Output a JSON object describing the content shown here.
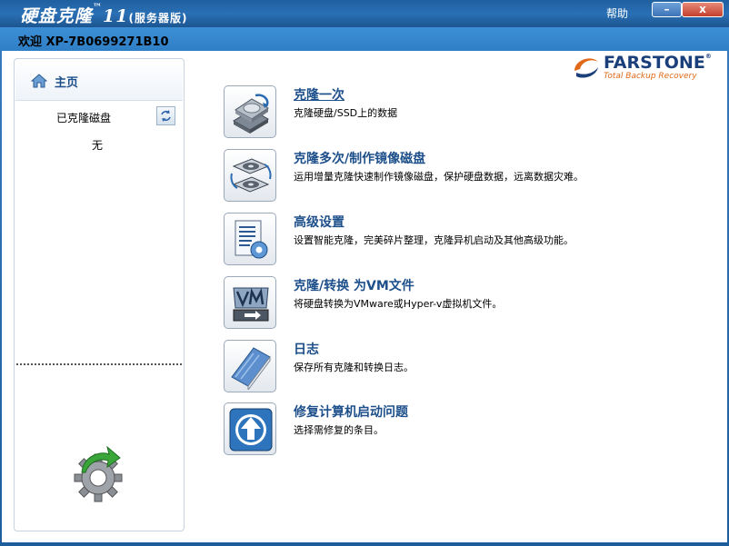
{
  "titlebar": {
    "app_name": "硬盘克隆",
    "tm": "™",
    "version": "11",
    "edition": "(服务器版)",
    "help": "帮助",
    "minimize": "–",
    "close": "x"
  },
  "welcome": "欢迎 XP-7B0699271B10",
  "logo": {
    "name": "FARSTONE",
    "tagline": "Total Backup Recovery",
    "reg": "®"
  },
  "sidebar": {
    "home_label": "主页",
    "cloned_disks_label": "已克隆磁盘",
    "none_label": "无"
  },
  "menu": [
    {
      "title": "克隆一次",
      "desc": "克隆硬盘/SSD上的数据",
      "icon": "hard-disk-clone-icon"
    },
    {
      "title": "克隆多次/制作镜像磁盘",
      "desc": "运用增量克隆快速制作镜像磁盘，保护硬盘数据，远离数据灾难。",
      "icon": "mirror-disk-icon"
    },
    {
      "title": "高级设置",
      "desc": "设置智能克隆，完美碎片整理，克隆异机启动及其他高级功能。",
      "icon": "settings-document-icon"
    },
    {
      "title": "克隆/转换 为VM文件",
      "desc": "将硬盘转换为VMware或Hyper-v虚拟机文件。",
      "icon": "vm-convert-icon"
    },
    {
      "title": "日志",
      "desc": "保存所有克隆和转换日志。",
      "icon": "log-book-icon"
    },
    {
      "title": "修复计算机启动问题",
      "desc": "选择需修复的条目。",
      "icon": "boot-repair-arrow-icon"
    }
  ]
}
